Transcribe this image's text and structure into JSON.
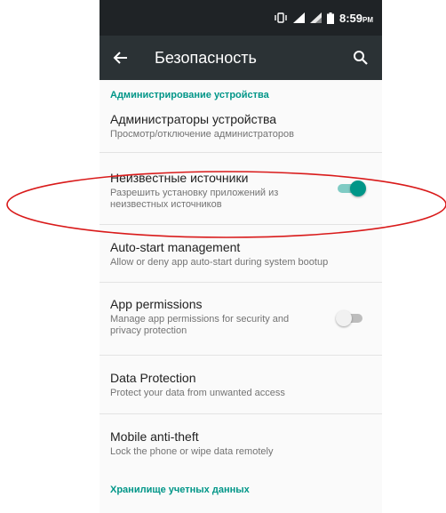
{
  "status_bar": {
    "time": "8:59",
    "ampm": "PM",
    "icons": [
      "vibrate-icon",
      "signal-icon",
      "signal-icon",
      "battery-icon"
    ]
  },
  "toolbar": {
    "title": "Безопасность",
    "back_icon": "arrow-left-icon",
    "search_icon": "search-icon"
  },
  "sections": {
    "device_admin_header": "Администрирование устройства",
    "credential_storage_header": "Хранилище учетных данных"
  },
  "items": {
    "device_admins": {
      "title": "Администраторы устройства",
      "subtitle": "Просмотр/отключение администраторов"
    },
    "unknown_sources": {
      "title": "Неизвестные источники",
      "subtitle": "Разрешить установку приложений из неизвестных источников",
      "enabled": true
    },
    "autostart": {
      "title": "Auto-start management",
      "subtitle": "Allow or deny app auto-start during system bootup"
    },
    "app_permissions": {
      "title": "App permissions",
      "subtitle": "Manage app permissions for security and privacy protection",
      "enabled": false
    },
    "data_protection": {
      "title": "Data Protection",
      "subtitle": "Protect your data from unwanted access"
    },
    "anti_theft": {
      "title": "Mobile anti-theft",
      "subtitle": "Lock the phone or wipe data remotely"
    }
  },
  "colors": {
    "accent": "#009688",
    "toolbar": "#2b3235",
    "statusbar": "#1f2326",
    "annotation": "#d91a1a"
  }
}
